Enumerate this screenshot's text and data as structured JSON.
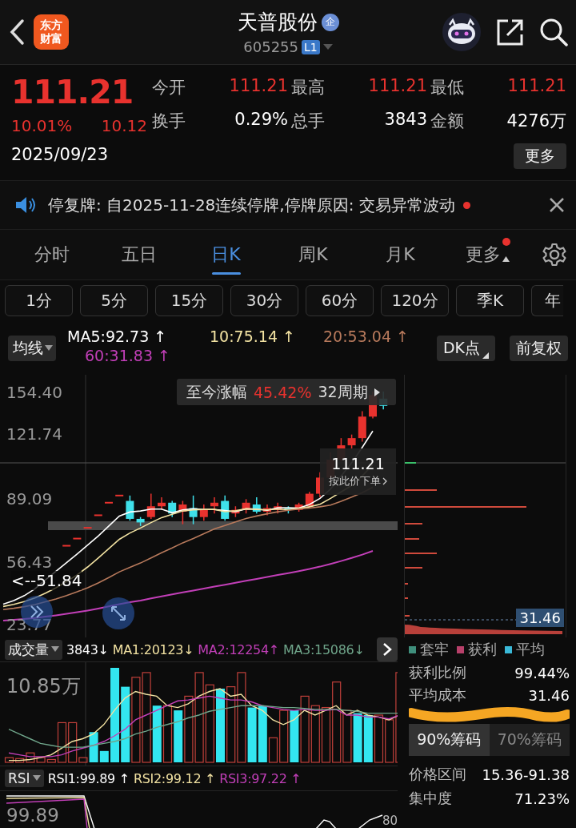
{
  "header": {
    "logo_text": "东方财富",
    "title": "天普股份",
    "title_badge": "企",
    "code": "605255",
    "level_badge": "L1"
  },
  "quote": {
    "price": "111.21",
    "change_percent": "10.01%",
    "change": "10.12",
    "date": "2025/09/23",
    "more_button": "更多",
    "stats": [
      {
        "label": "今开",
        "value": "111.21",
        "color": "#e8322e"
      },
      {
        "label": "最高",
        "value": "111.21",
        "color": "#e8322e"
      },
      {
        "label": "最低",
        "value": "111.21",
        "color": "#e8322e"
      },
      {
        "label": "换手",
        "value": "0.29%",
        "color": "#ffffff"
      },
      {
        "label": "总手",
        "value": "3843",
        "color": "#ffffff"
      },
      {
        "label": "金额",
        "value": "4276万",
        "color": "#ffffff"
      }
    ]
  },
  "notice": {
    "text": "停复牌: 自2025-11-28连续停牌,停牌原因: 交易异常波动",
    "unread": true
  },
  "tabs": [
    {
      "label": "分时",
      "selected": false,
      "kind": "plain"
    },
    {
      "label": "五日",
      "selected": false,
      "kind": "plain"
    },
    {
      "label": "日K",
      "selected": true,
      "kind": "plain"
    },
    {
      "label": "周K",
      "selected": false,
      "kind": "plain"
    },
    {
      "label": "月K",
      "selected": false,
      "kind": "plain"
    },
    {
      "label": "更多",
      "selected": false,
      "kind": "menu",
      "has_dot": true
    }
  ],
  "periods": [
    "1分",
    "5分",
    "15分",
    "30分",
    "60分",
    "120分",
    "季K",
    "年"
  ],
  "ma_bar": {
    "selector": "均线",
    "dk_button": "DK点",
    "adjust_button": "前复权",
    "lines": [
      {
        "text": "MA5:92.73 ↑",
        "color": "#ffffff"
      },
      {
        "text": "10:75.14 ↑",
        "color": "#f2e2a2"
      },
      {
        "text": "20:53.04 ↑",
        "color": "#b87a5c"
      },
      {
        "text": "60:31.83 ↑",
        "color": "#c23fb8"
      }
    ]
  },
  "kline": {
    "price_labels": [
      "154.40",
      "121.74",
      "89.09",
      "56.43",
      "23.77"
    ],
    "range_tag": {
      "label": "至今涨幅",
      "value": "45.42%",
      "periods": "32周期"
    },
    "price_tooltip": {
      "price": "111.21",
      "action": "按此价下单"
    },
    "low_marker": "<--51.84",
    "avg_cost_tag": "31.46"
  },
  "volume": {
    "selector": "成交量",
    "axis_label": "10.85万",
    "items": [
      {
        "text": "3843↓",
        "color": "#ffffff"
      },
      {
        "text": "MA1:20123↓",
        "color": "#f2e2a2"
      },
      {
        "text": "MA2:12254↑",
        "color": "#c23fb8"
      },
      {
        "text": "MA3:15086↓",
        "color": "#6fa58a"
      }
    ]
  },
  "rsi": {
    "selector": "RSI",
    "axis_labels": [
      "99.89",
      "80"
    ],
    "items": [
      {
        "text": "RSI1:99.89 ↑",
        "color": "#ffffff"
      },
      {
        "text": "RSI2:99.12 ↑",
        "color": "#f2e2a2"
      },
      {
        "text": "RSI3:97.22 ↑",
        "color": "#c23fb8"
      }
    ]
  },
  "chip_panel": {
    "legend": [
      {
        "label": "套牢",
        "color": "#3f8f7c"
      },
      {
        "label": "获利",
        "color": "#b8406a"
      },
      {
        "label": "平均",
        "color": "#3ab9d8"
      }
    ],
    "stats": [
      {
        "label": "获利比例",
        "value": "99.44%"
      },
      {
        "label": "平均成本",
        "value": "31.46"
      }
    ],
    "tabs": [
      {
        "label": "90%筹码",
        "selected": true
      },
      {
        "label": "70%筹码",
        "selected": false
      }
    ],
    "range_stats": [
      {
        "label": "价格区间",
        "value": "15.36-91.38"
      },
      {
        "label": "集中度",
        "value": "71.23%"
      }
    ]
  }
}
